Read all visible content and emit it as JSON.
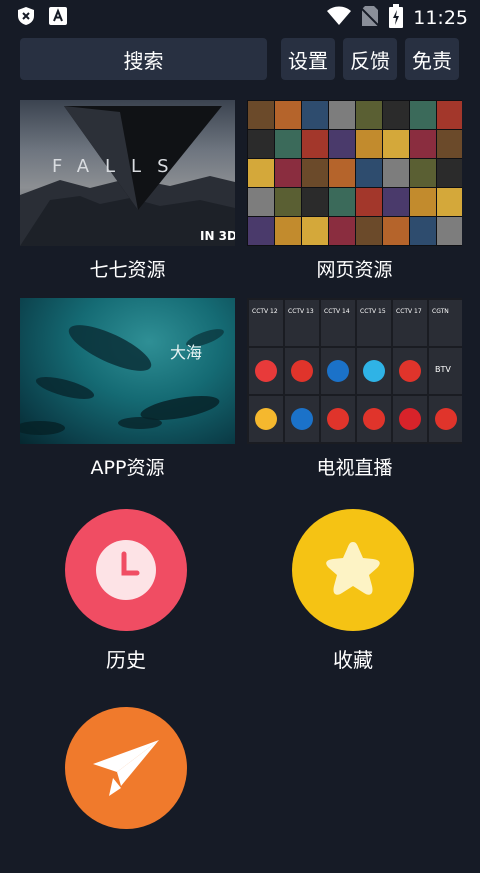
{
  "status_bar": {
    "time": "11:25",
    "left_icons": [
      "shield-x-icon",
      "auto-a-icon"
    ],
    "right_icons": [
      "wifi-icon",
      "no-sim-icon",
      "battery-charging-icon"
    ]
  },
  "toolbar": {
    "search_label": "搜索",
    "settings_label": "设置",
    "feedback_label": "反馈",
    "disclaimer_label": "免责"
  },
  "tiles": [
    {
      "label": "七七资源",
      "image": "movie-poster-falls-3d",
      "badge": "IN 3D",
      "title": "FALLS"
    },
    {
      "label": "网页资源",
      "image": "movie-poster-grid"
    },
    {
      "label": "APP资源",
      "image": "ocean-whales-poster",
      "caption": "大海"
    },
    {
      "label": "电视直播",
      "image": "tv-channel-logos-grid",
      "channels": [
        "CCTV 12",
        "CCTV 13",
        "CCTV 14",
        "CCTV 15",
        "CCTV 17",
        "CGTN",
        "BTV"
      ]
    }
  ],
  "shortcuts": [
    {
      "label": "历史",
      "icon": "clock-icon",
      "color": "#f04d63"
    },
    {
      "label": "收藏",
      "icon": "star-icon",
      "color": "#f5c314"
    },
    {
      "label": "",
      "icon": "paper-plane-icon",
      "color": "#f07a2c"
    }
  ],
  "colors": {
    "background": "#161b26",
    "button_bg": "#283041",
    "text": "#ffffff"
  }
}
